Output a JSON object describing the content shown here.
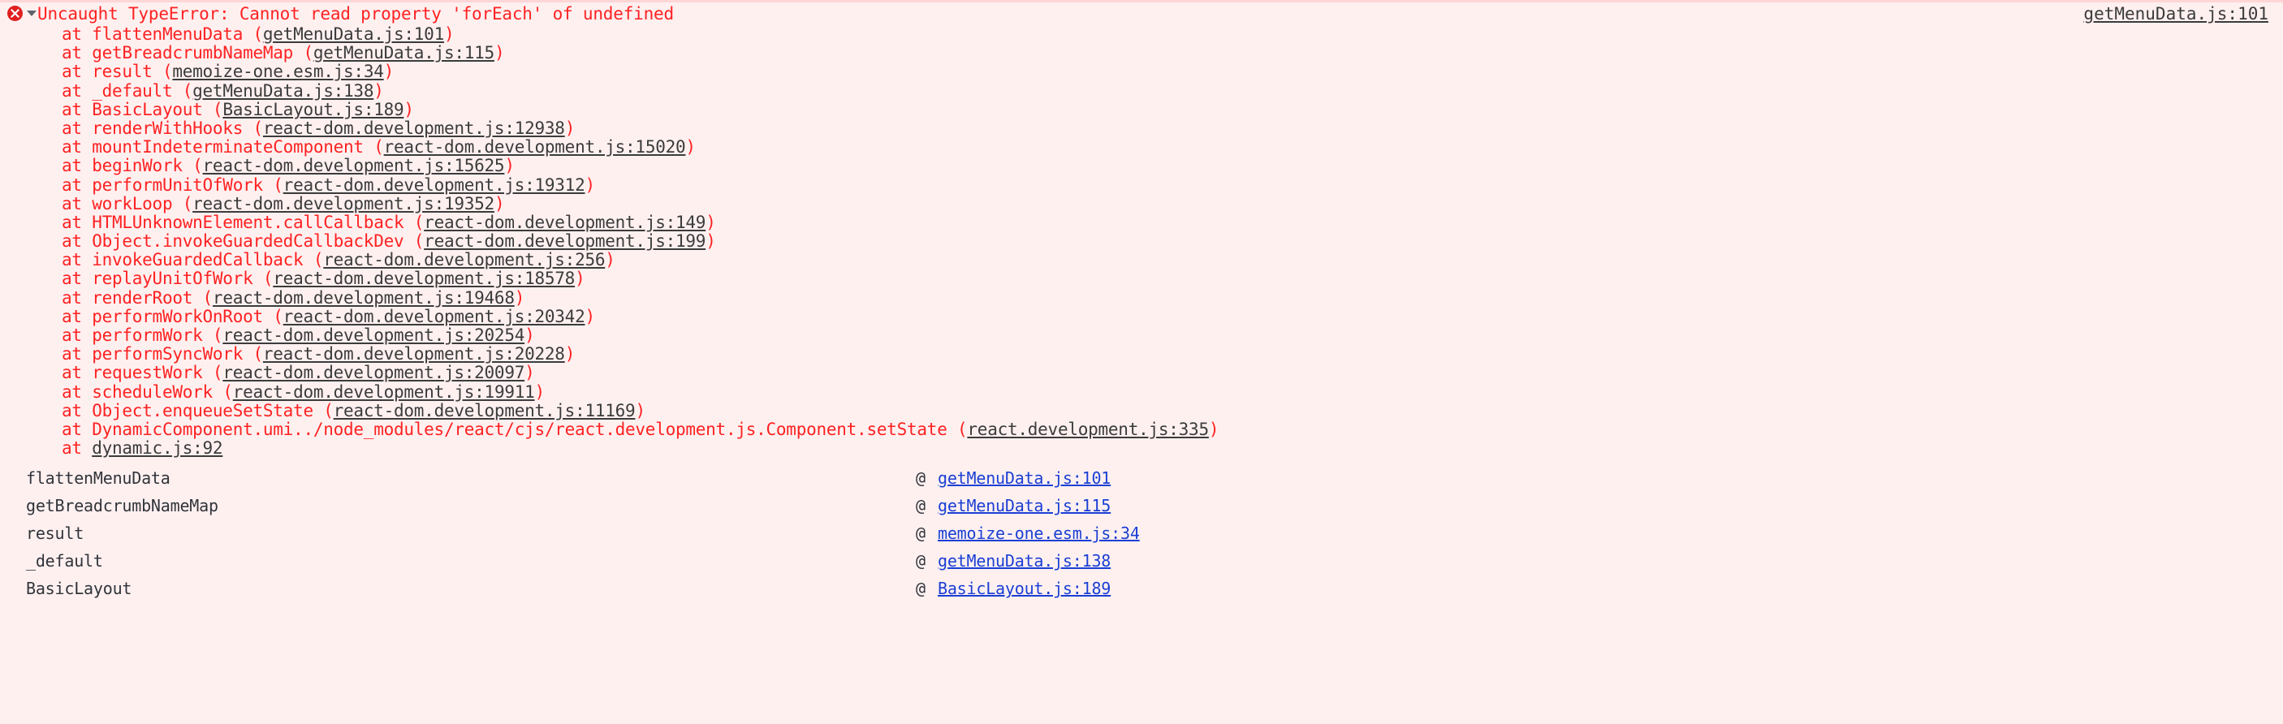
{
  "panel": {
    "background_color": "#fff0f0",
    "top_border_color": "#ffd6d6",
    "error_text_color": "#ff2222",
    "link_color_stack": "#3b3b3b",
    "link_color_frames": "#1a3fd4",
    "icon_color": "#e02020"
  },
  "error": {
    "icon": "error-circle-x-icon",
    "disclosure": "triangle-down-icon",
    "message": "Uncaught TypeError: Cannot read property 'forEach' of undefined",
    "source_link": "getMenuData.js:101"
  },
  "stack_trace": [
    {
      "prefix": "    at ",
      "fn": "flattenMenuData",
      "src": "getMenuData.js:101"
    },
    {
      "prefix": "    at ",
      "fn": "getBreadcrumbNameMap",
      "src": "getMenuData.js:115"
    },
    {
      "prefix": "    at ",
      "fn": "result",
      "src": "memoize-one.esm.js:34"
    },
    {
      "prefix": "    at ",
      "fn": "_default",
      "src": "getMenuData.js:138"
    },
    {
      "prefix": "    at ",
      "fn": "BasicLayout",
      "src": "BasicLayout.js:189"
    },
    {
      "prefix": "    at ",
      "fn": "renderWithHooks",
      "src": "react-dom.development.js:12938"
    },
    {
      "prefix": "    at ",
      "fn": "mountIndeterminateComponent",
      "src": "react-dom.development.js:15020"
    },
    {
      "prefix": "    at ",
      "fn": "beginWork",
      "src": "react-dom.development.js:15625"
    },
    {
      "prefix": "    at ",
      "fn": "performUnitOfWork",
      "src": "react-dom.development.js:19312"
    },
    {
      "prefix": "    at ",
      "fn": "workLoop",
      "src": "react-dom.development.js:19352"
    },
    {
      "prefix": "    at ",
      "fn": "HTMLUnknownElement.callCallback",
      "src": "react-dom.development.js:149"
    },
    {
      "prefix": "    at ",
      "fn": "Object.invokeGuardedCallbackDev",
      "src": "react-dom.development.js:199"
    },
    {
      "prefix": "    at ",
      "fn": "invokeGuardedCallback",
      "src": "react-dom.development.js:256"
    },
    {
      "prefix": "    at ",
      "fn": "replayUnitOfWork",
      "src": "react-dom.development.js:18578"
    },
    {
      "prefix": "    at ",
      "fn": "renderRoot",
      "src": "react-dom.development.js:19468"
    },
    {
      "prefix": "    at ",
      "fn": "performWorkOnRoot",
      "src": "react-dom.development.js:20342"
    },
    {
      "prefix": "    at ",
      "fn": "performWork",
      "src": "react-dom.development.js:20254"
    },
    {
      "prefix": "    at ",
      "fn": "performSyncWork",
      "src": "react-dom.development.js:20228"
    },
    {
      "prefix": "    at ",
      "fn": "requestWork",
      "src": "react-dom.development.js:20097"
    },
    {
      "prefix": "    at ",
      "fn": "scheduleWork",
      "src": "react-dom.development.js:19911"
    },
    {
      "prefix": "    at ",
      "fn": "Object.enqueueSetState",
      "src": "react-dom.development.js:11169"
    },
    {
      "prefix": "    at ",
      "fn": "DynamicComponent.umi../node_modules/react/cjs/react.development.js.Component.setState",
      "src": "react.development.js:335"
    },
    {
      "prefix": "    at ",
      "fn": "",
      "src": "dynamic.js:92"
    }
  ],
  "frames": [
    {
      "fn": "flattenMenuData",
      "at": "@",
      "link": "getMenuData.js:101"
    },
    {
      "fn": "getBreadcrumbNameMap",
      "at": "@",
      "link": "getMenuData.js:115"
    },
    {
      "fn": "result",
      "at": "@",
      "link": "memoize-one.esm.js:34"
    },
    {
      "fn": "_default",
      "at": "@",
      "link": "getMenuData.js:138"
    },
    {
      "fn": "BasicLayout",
      "at": "@",
      "link": "BasicLayout.js:189"
    }
  ]
}
